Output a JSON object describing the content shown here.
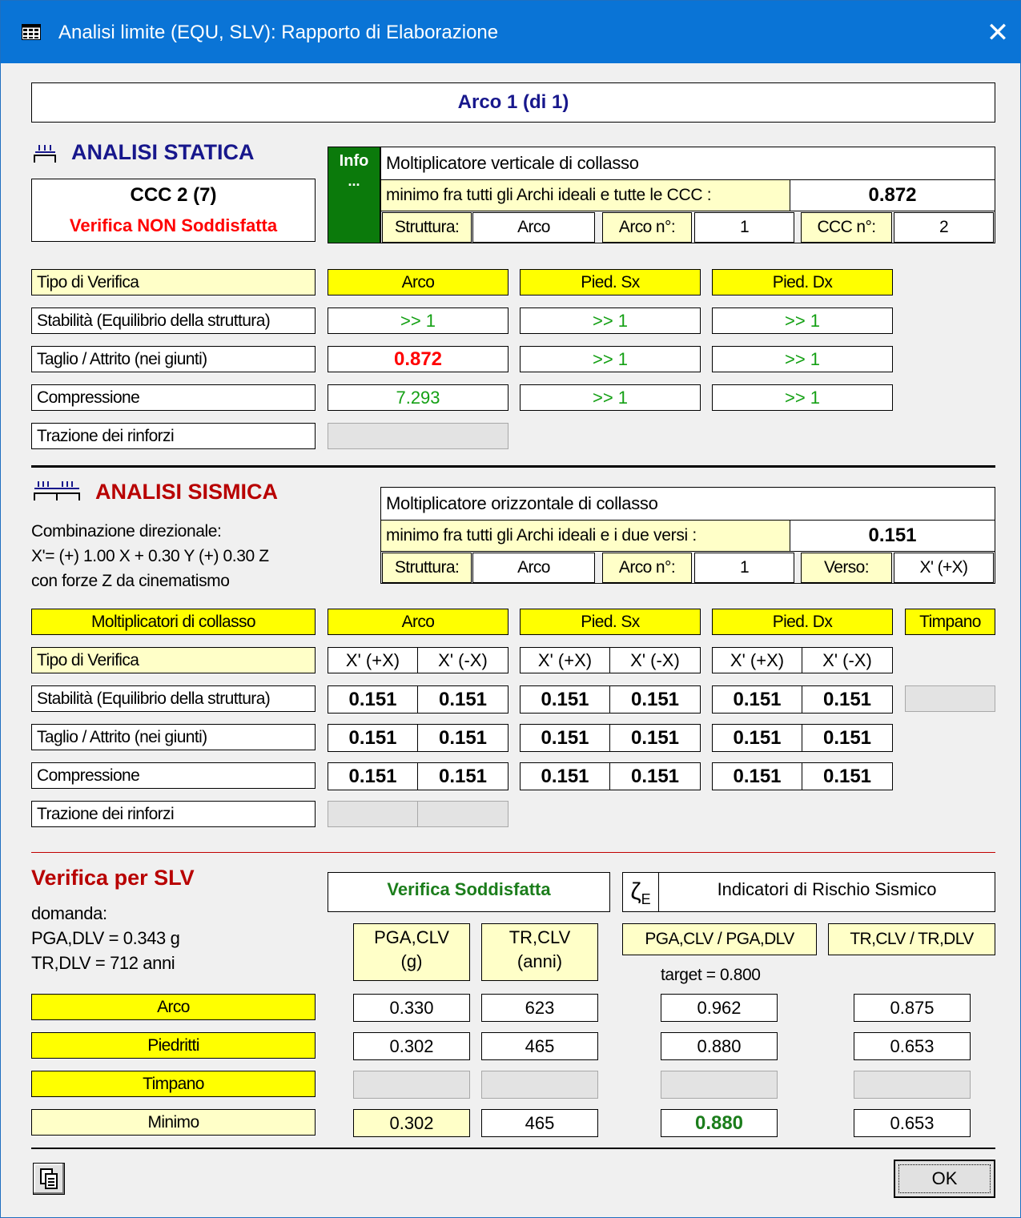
{
  "window": {
    "title": "Analisi limite (EQU, SLV): Rapporto di Elaborazione",
    "close_glyph": "✕"
  },
  "header": {
    "arc_title": "Arco 1 (di 1)"
  },
  "static": {
    "title": "ANALISI STATICA",
    "ccc": "CCC 2 (7)",
    "verdict": "Verifica NON Soddisfatta",
    "info": {
      "badge": "Info",
      "badge_sub": "...",
      "heading": "Moltiplicatore verticale di collasso",
      "min_label": "minimo fra tutti gli Archi ideali e tutte le CCC :",
      "min_value": "0.872",
      "struttura_label": "Struttura:",
      "struttura_value": "Arco",
      "arco_label": "Arco n°:",
      "arco_value": "1",
      "third_label": "CCC n°:",
      "third_value": "2"
    },
    "table": {
      "header_label": "Tipo di Verifica",
      "columns": [
        "Arco",
        "Pied. Sx",
        "Pied. Dx"
      ],
      "rows": [
        {
          "label": "Stabilità (Equilibrio della struttura)",
          "values": [
            ">> 1",
            ">> 1",
            ">> 1"
          ]
        },
        {
          "label": "Taglio / Attrito (nei giunti)",
          "values": [
            "0.872",
            ">> 1",
            ">> 1"
          ]
        },
        {
          "label": "Compressione",
          "values": [
            "7.293",
            ">> 1",
            ">> 1"
          ]
        },
        {
          "label": "Trazione dei rinforzi",
          "values": []
        }
      ]
    }
  },
  "seismic": {
    "title": "ANALISI SISMICA",
    "combo_lines": [
      "Combinazione direzionale:",
      "X'= (+) 1.00 X + 0.30 Y (+) 0.30 Z",
      "con forze Z da cinematismo"
    ],
    "info": {
      "heading": "Moltiplicatore orizzontale di collasso",
      "min_label": "minimo fra tutti gli Archi ideali e i due versi :",
      "min_value": "0.151",
      "struttura_label": "Struttura:",
      "struttura_value": "Arco",
      "arco_label": "Arco n°:",
      "arco_value": "1",
      "third_label": "Verso:",
      "third_value": "X' (+X)"
    },
    "table": {
      "header_label": "Moltiplicatori di collasso",
      "columns": [
        "Arco",
        "Pied. Sx",
        "Pied. Dx",
        "Timpano"
      ],
      "type_label": "Tipo di Verifica",
      "directions": [
        "X' (+X)",
        "X' (-X)"
      ],
      "rows": [
        {
          "label": "Stabilità (Equilibrio della struttura)",
          "values": [
            "0.151",
            "0.151",
            "0.151",
            "0.151",
            "0.151",
            "0.151"
          ]
        },
        {
          "label": "Taglio / Attrito (nei giunti)",
          "values": [
            "0.151",
            "0.151",
            "0.151",
            "0.151",
            "0.151",
            "0.151"
          ]
        },
        {
          "label": "Compressione",
          "values": [
            "0.151",
            "0.151",
            "0.151",
            "0.151",
            "0.151",
            "0.151"
          ]
        },
        {
          "label": "Trazione dei rinforzi",
          "values": []
        }
      ]
    }
  },
  "slv": {
    "title": "Verifica per SLV",
    "demand_label": "domanda:",
    "pga_dlv": "PGA,DLV = 0.343 g",
    "tr_dlv": "TR,DLV = 712 anni",
    "verdict": "Verifica Soddisfatta",
    "zeta_symbol": "ζ",
    "zeta_sub": "E",
    "risk_label": "Indicatori di Rischio Sismico",
    "col_pga": [
      "PGA,CLV",
      "(g)"
    ],
    "col_tr": [
      "TR,CLV",
      "(anni)"
    ],
    "col_ratio_pga": "PGA,CLV / PGA,DLV",
    "col_ratio_tr": "TR,CLV / TR,DLV",
    "target": "target = 0.800",
    "rows": [
      {
        "label": "Arco",
        "pga": "0.330",
        "tr": "623",
        "ratio_pga": "0.962",
        "ratio_tr": "0.875"
      },
      {
        "label": "Piedritti",
        "pga": "0.302",
        "tr": "465",
        "ratio_pga": "0.880",
        "ratio_tr": "0.653"
      },
      {
        "label": "Timpano",
        "pga": "",
        "tr": "",
        "ratio_pga": "",
        "ratio_tr": ""
      },
      {
        "label": "Minimo",
        "pga": "0.302",
        "tr": "465",
        "ratio_pga": "0.880",
        "ratio_tr": "0.653"
      }
    ]
  },
  "footer": {
    "ok_label": "OK"
  }
}
